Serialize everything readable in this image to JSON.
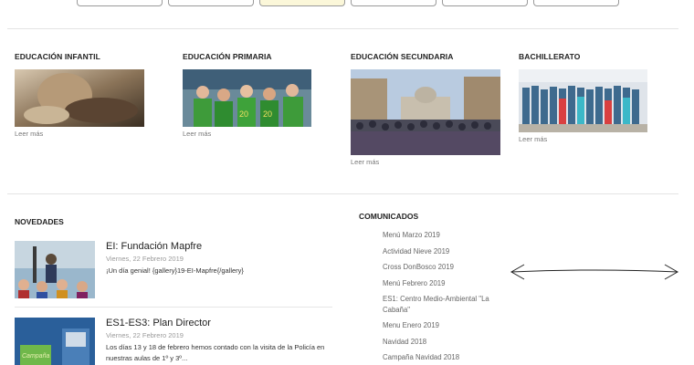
{
  "levels": [
    {
      "title": "EDUCACIÓN INFANTIL",
      "more": "Leer más"
    },
    {
      "title": "EDUCACIÓN PRIMARIA",
      "more": "Leer más"
    },
    {
      "title": "EDUCACIÓN SECUNDARIA",
      "more": "Leer más"
    },
    {
      "title": "BACHILLERATO",
      "more": "Leer más"
    }
  ],
  "novedades": {
    "title": "NOVEDADES",
    "items": [
      {
        "title": "EI: Fundación Mapfre",
        "date": "Viernes, 22 Febrero 2019",
        "text": "¡Un día genial! {gallery}19-EI-Mapfre{/gallery}"
      },
      {
        "title": "ES1-ES3: Plan Director",
        "date": "Viernes, 22 Febrero 2019",
        "text": "Los días 13 y 18 de febrero hemos contado con la visita de la Policía en nuestras aulas de 1º y 3º..."
      }
    ]
  },
  "comunicados": {
    "title": "COMUNICADOS",
    "items": [
      "Menú Marzo 2019",
      "Actividad Nieve 2019",
      "Cross DonBosco 2019",
      "Menú Febrero 2019",
      "ES1: Centro Medio-Ambiental \"La Cabaña\"",
      "Menu Enero 2019",
      "Navidad 2018",
      "Campaña Navidad 2018"
    ]
  },
  "colors": {
    "active_tab": "#fbf7d9",
    "divider": "#e4e4e4"
  }
}
